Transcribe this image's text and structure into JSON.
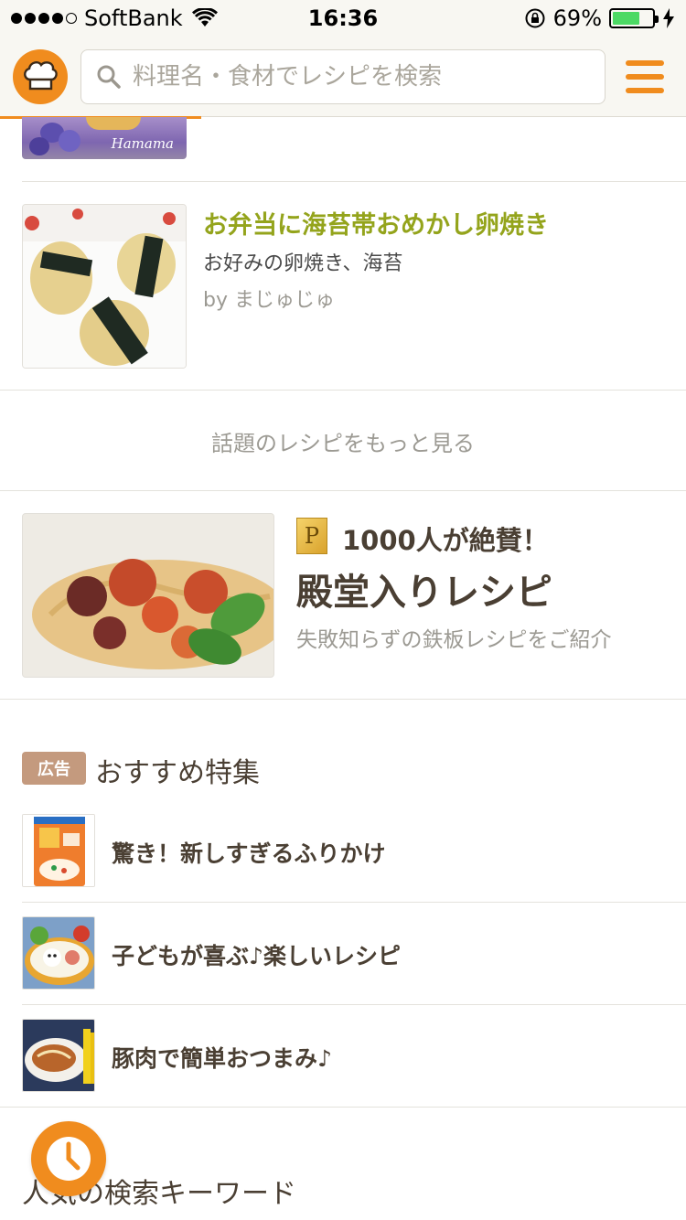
{
  "status_bar": {
    "carrier": "SoftBank",
    "time": "16:36",
    "battery": "69%",
    "battery_level": 0.69
  },
  "header": {
    "search_placeholder": "料理名・食材でレシピを検索"
  },
  "partial_card": {
    "image_watermark": "Hamama"
  },
  "recipe": {
    "title": "お弁当に海苔帯おめかし卵焼き",
    "description": "お好みの卵焼き、海苔",
    "author": "by まじゅじゅ"
  },
  "more_link": "話題のレシピをもっと見る",
  "hall_of_fame": {
    "badge": "P",
    "headline": "1000人が絶賛！",
    "title": "殿堂入りレシピ",
    "subtitle": "失敗知らずの鉄板レシピをご紹介"
  },
  "features": {
    "ad_badge": "広告",
    "heading": "おすすめ特集",
    "items": [
      {
        "label": "驚き！新しすぎるふりかけ",
        "icon": "furikake-package"
      },
      {
        "label": "子どもが喜ぶ♪楽しいレシピ",
        "icon": "kids-bento"
      },
      {
        "label": "豚肉で簡単おつまみ♪",
        "icon": "pork-dish"
      }
    ]
  },
  "keywords_heading": "人気の検索キーワード",
  "colors": {
    "brand_orange": "#f08c1e",
    "recipe_title_green": "#94a41c",
    "ad_badge": "#c49a7e"
  }
}
